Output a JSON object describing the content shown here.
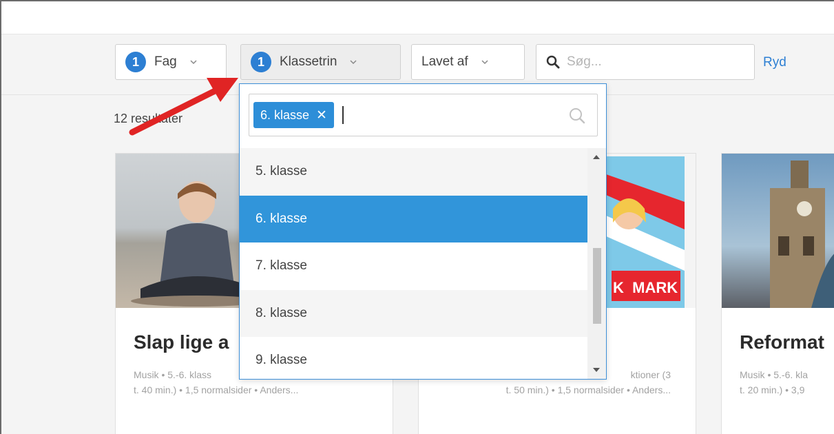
{
  "filters": {
    "fag": {
      "badge": "1",
      "label": "Fag"
    },
    "klassetrin": {
      "badge": "1",
      "label": "Klassetrin"
    },
    "lavet_af": {
      "label": "Lavet af"
    },
    "search_placeholder": "Søg...",
    "clear_label": "Ryd"
  },
  "results": {
    "count_label": "12 resultater"
  },
  "cards": [
    {
      "title": "Slap lige a",
      "meta_line1": "Musik • 5.-6. klass",
      "meta_line2": "t. 40 min.) • 1,5 normalsider • Anders..."
    },
    {
      "title": "",
      "meta_line1": "ktioner (3",
      "meta_line2": "t. 50 min.) • 1,5 normalsider • Anders...",
      "image_text": "K  MARK"
    },
    {
      "title": "Reformat",
      "meta_line1": "Musik • 5.-6. kla",
      "meta_line2": "t. 20 min.) • 3,9"
    }
  ],
  "dropdown": {
    "selected_chip": "6. klasse",
    "chip_remove": "✕",
    "options": [
      "5. klasse",
      "6. klasse",
      "7. klasse",
      "8. klasse",
      "9. klasse"
    ]
  },
  "colors": {
    "accent": "#2d7fd3",
    "selected_option": "#3195da",
    "arrow": "#e02424"
  }
}
